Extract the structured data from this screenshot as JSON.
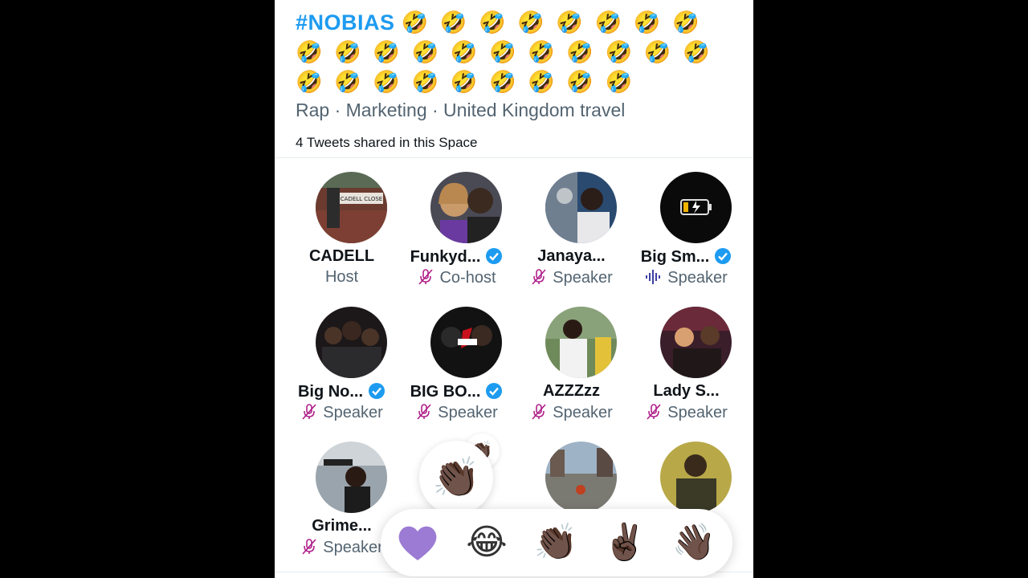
{
  "space": {
    "title_hashtag": "#NOBIAS",
    "title_emojis": "🤣 🤣 🤣 🤣 🤣 🤣 🤣 🤣 🤣 🤣 🤣 🤣 🤣 🤣 🤣 🤣 🤣 🤣 🤣 🤣 🤣 🤣 🤣 🤣 🤣 🤣 🤣 🤣",
    "topics": "Rap · Marketing · United Kingdom travel",
    "tweets_shared": "4 Tweets shared in this Space"
  },
  "participants": [
    {
      "name": "CADELL",
      "role": "Host",
      "verified": false,
      "role_icon": "none"
    },
    {
      "name": "Funkyd...",
      "role": "Co-host",
      "verified": true,
      "role_icon": "mic-muted-icon"
    },
    {
      "name": "Janaya...",
      "role": "Speaker",
      "verified": false,
      "role_icon": "mic-muted-icon"
    },
    {
      "name": "Big Sm...",
      "role": "Speaker",
      "verified": true,
      "role_icon": "speaking-waveform-icon"
    },
    {
      "name": "Big No...",
      "role": "Speaker",
      "verified": true,
      "role_icon": "mic-muted-icon"
    },
    {
      "name": "BIG BO...",
      "role": "Speaker",
      "verified": true,
      "role_icon": "mic-muted-icon"
    },
    {
      "name": "AZZZzz",
      "role": "Speaker",
      "verified": false,
      "role_icon": "mic-muted-icon"
    },
    {
      "name": "Lady S...",
      "role": "Speaker",
      "verified": false,
      "role_icon": "mic-muted-icon"
    },
    {
      "name": "Grime...",
      "role": "Speaker",
      "verified": false,
      "role_icon": "mic-muted-icon"
    },
    {
      "name": "",
      "role": "",
      "verified": false,
      "role_icon": "none"
    },
    {
      "name": "",
      "role": "",
      "verified": false,
      "role_icon": "none"
    },
    {
      "name": "",
      "role": "",
      "verified": false,
      "role_icon": "none"
    }
  ],
  "reaction_overlay": {
    "emoji": "👏🏿",
    "small_emoji": "👏🏿"
  },
  "reactions": [
    {
      "name": "purple-heart",
      "emoji": "💜"
    },
    {
      "name": "tears-of-joy",
      "emoji": "😂"
    },
    {
      "name": "clapping-hands",
      "emoji": "👏🏿"
    },
    {
      "name": "victory-hand",
      "emoji": "✌🏿"
    },
    {
      "name": "waving-hand",
      "emoji": "👋🏿"
    }
  ],
  "colors": {
    "accent": "#1d9bf0",
    "muted_mic": "#b0208a",
    "speaking": "#3d3fa6",
    "verified": "#1d9bf0",
    "secondary_text": "#536471"
  }
}
